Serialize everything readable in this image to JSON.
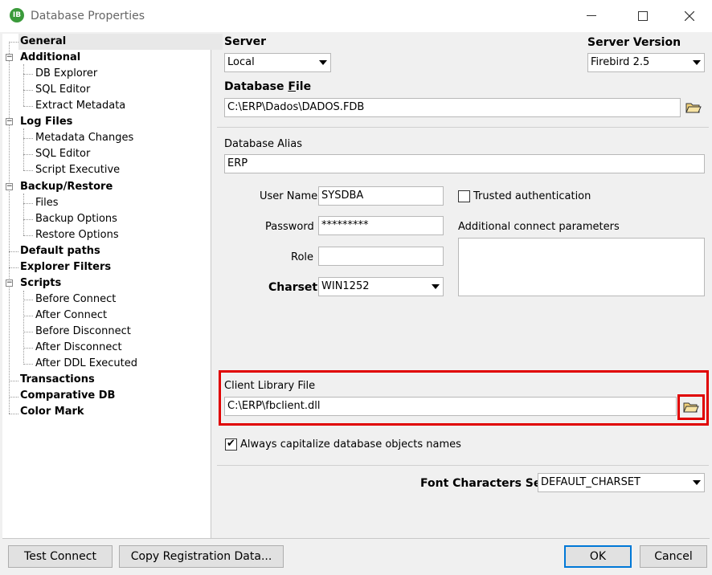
{
  "window": {
    "title": "Database Properties",
    "icon_text": "IB"
  },
  "tree": {
    "general": "General",
    "additional": "Additional",
    "db_explorer": "DB Explorer",
    "sql_editor_1": "SQL Editor",
    "extract_metadata": "Extract Metadata",
    "log_files": "Log Files",
    "metadata_changes": "Metadata Changes",
    "sql_editor_2": "SQL Editor",
    "script_executive": "Script Executive",
    "backup_restore": "Backup/Restore",
    "files": "Files",
    "backup_options": "Backup Options",
    "restore_options": "Restore Options",
    "default_paths": "Default paths",
    "explorer_filters": "Explorer Filters",
    "scripts": "Scripts",
    "before_connect": "Before Connect",
    "after_connect": "After Connect",
    "before_disconnect": "Before Disconnect",
    "after_disconnect": "After Disconnect",
    "after_ddl_executed": "After DDL Executed",
    "transactions": "Transactions",
    "comparative_db": "Comparative DB",
    "color_mark": "Color Mark"
  },
  "form": {
    "server_label": "Server",
    "server_value": "Local",
    "server_version_label": "Server Version",
    "server_version_value": "Firebird 2.5",
    "database_file_label_pre": "Database ",
    "database_file_label_u": "F",
    "database_file_label_post": "ile",
    "database_file_value": "C:\\ERP\\Dados\\DADOS.FDB",
    "alias_label": "Database Alias",
    "alias_value": "ERP",
    "user_name_label": "User Name",
    "user_name_value": "SYSDBA",
    "password_label": "Password",
    "password_value": "*********",
    "role_label": "Role",
    "role_value": "",
    "charset_label": "Charset",
    "charset_value": "WIN1252",
    "trusted_auth_label": "Trusted authentication",
    "trusted_auth_checked": false,
    "additional_params_label": "Additional connect parameters",
    "client_library_label": "Client Library File",
    "client_library_value": "C:\\ERP\\fbclient.dll",
    "capitalize_label": "Always capitalize database objects names",
    "capitalize_checked": true,
    "font_charset_label": "Font Characters Set",
    "font_charset_value": "DEFAULT_CHARSET"
  },
  "buttons": {
    "test_connect": "Test Connect",
    "copy_registration": "Copy Registration Data...",
    "ok": "OK",
    "cancel": "Cancel"
  },
  "colors": {
    "highlight_box": "#e00000",
    "default_button_border": "#0078d7"
  },
  "icons": [
    "app-icon",
    "minimize-icon",
    "maximize-icon",
    "close-icon",
    "folder-open-icon",
    "dropdown-arrow-icon",
    "tree-expand-icon"
  ]
}
